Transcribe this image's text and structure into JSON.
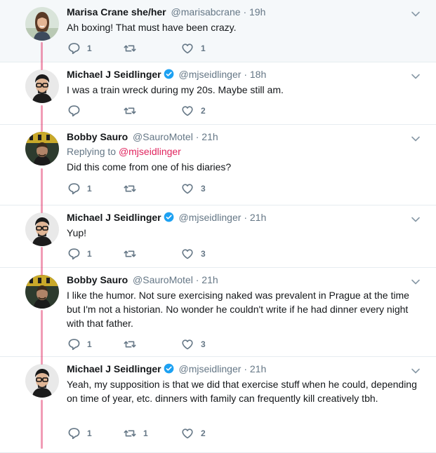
{
  "tweets": [
    {
      "name": "Marisa Crane she/her",
      "handle": "@marisabcrane",
      "time": "19h",
      "verified": false,
      "text": "Ah boxing! That must have been crazy.",
      "reply_count": "1",
      "retweet_count": "",
      "like_count": "1",
      "avatar": "marisa"
    },
    {
      "name": "Michael J Seidlinger",
      "handle": "@mjseidlinger",
      "time": "18h",
      "verified": true,
      "text": "I was a train wreck during my 20s. Maybe still am.",
      "reply_count": "",
      "retweet_count": "",
      "like_count": "2",
      "avatar": "michael"
    },
    {
      "name": "Bobby Sauro",
      "handle": "@SauroMotel",
      "time": "21h",
      "verified": false,
      "replying_prefix": "Replying to",
      "replying_to": "@mjseidlinger",
      "text": "Did this come from one of his diaries?",
      "reply_count": "1",
      "retweet_count": "",
      "like_count": "3",
      "avatar": "bobby"
    },
    {
      "name": "Michael J Seidlinger",
      "handle": "@mjseidlinger",
      "time": "21h",
      "verified": true,
      "text": "Yup!",
      "reply_count": "1",
      "retweet_count": "",
      "like_count": "3",
      "avatar": "michael"
    },
    {
      "name": "Bobby Sauro",
      "handle": "@SauroMotel",
      "time": "21h",
      "verified": false,
      "text": "I like the humor. Not sure exercising naked was prevalent in Prague at the time but I'm not a historian. No wonder he couldn't write if he had dinner every night with that father.",
      "reply_count": "1",
      "retweet_count": "",
      "like_count": "3",
      "avatar": "bobby"
    },
    {
      "name": "Michael J Seidlinger",
      "handle": "@mjseidlinger",
      "time": "21h",
      "verified": true,
      "text": "Yeah, my supposition is that we did that exercise stuff when he could, depending on time of year, etc. dinners with family can frequently kill creatively tbh.",
      "reply_count": "1",
      "retweet_count": "1",
      "like_count": "2",
      "avatar": "michael"
    }
  ],
  "separator": "·",
  "colors": {
    "text": "#14171a",
    "secondary": "#657786",
    "mention": "#e0245e",
    "thread_line": "#e0245e",
    "verified": "#1da1f2",
    "highlight_bg": "#f5f8fa",
    "border": "#e6ecf0"
  },
  "icons": {
    "reply": "reply-icon",
    "retweet": "retweet-icon",
    "like": "heart-icon",
    "verified": "verified-badge-icon",
    "menu": "chevron-down-icon"
  }
}
